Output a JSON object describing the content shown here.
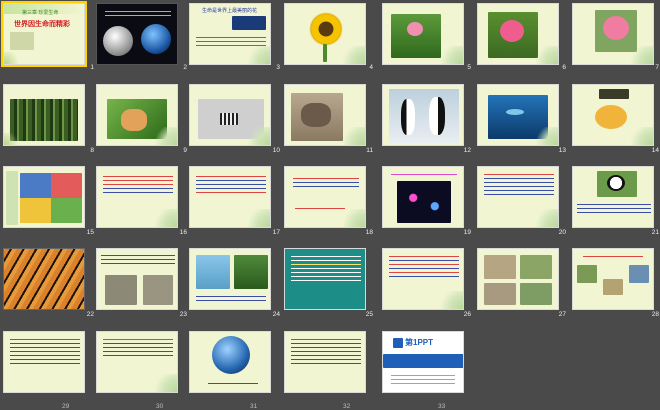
{
  "selected_slide": 1,
  "slides": [
    {
      "n": "1",
      "label": "第三章 珍爱生命",
      "title": "世界因生命而精彩"
    },
    {
      "n": "2",
      "label": ""
    },
    {
      "n": "3",
      "label": "生命是世界上最美丽的花"
    },
    {
      "n": "4",
      "label": ""
    },
    {
      "n": "5",
      "label": ""
    },
    {
      "n": "6",
      "label": ""
    },
    {
      "n": "7",
      "label": ""
    },
    {
      "n": "8",
      "label": ""
    },
    {
      "n": "9",
      "label": ""
    },
    {
      "n": "10",
      "label": ""
    },
    {
      "n": "11",
      "label": ""
    },
    {
      "n": "12",
      "label": ""
    },
    {
      "n": "13",
      "label": ""
    },
    {
      "n": "14",
      "label": ""
    },
    {
      "n": "15",
      "label": ""
    },
    {
      "n": "16",
      "label": ""
    },
    {
      "n": "17",
      "label": ""
    },
    {
      "n": "18",
      "label": ""
    },
    {
      "n": "19",
      "label": ""
    },
    {
      "n": "20",
      "label": ""
    },
    {
      "n": "21",
      "label": ""
    },
    {
      "n": "22",
      "label": ""
    },
    {
      "n": "23",
      "label": ""
    },
    {
      "n": "24",
      "label": ""
    },
    {
      "n": "25",
      "label": ""
    },
    {
      "n": "26",
      "label": ""
    },
    {
      "n": "27",
      "label": ""
    },
    {
      "n": "28",
      "label": ""
    },
    {
      "n": "29",
      "label": ""
    },
    {
      "n": "30",
      "label": ""
    },
    {
      "n": "31",
      "label": ""
    },
    {
      "n": "32",
      "label": ""
    },
    {
      "n": "33",
      "label": "第1PPT"
    }
  ]
}
